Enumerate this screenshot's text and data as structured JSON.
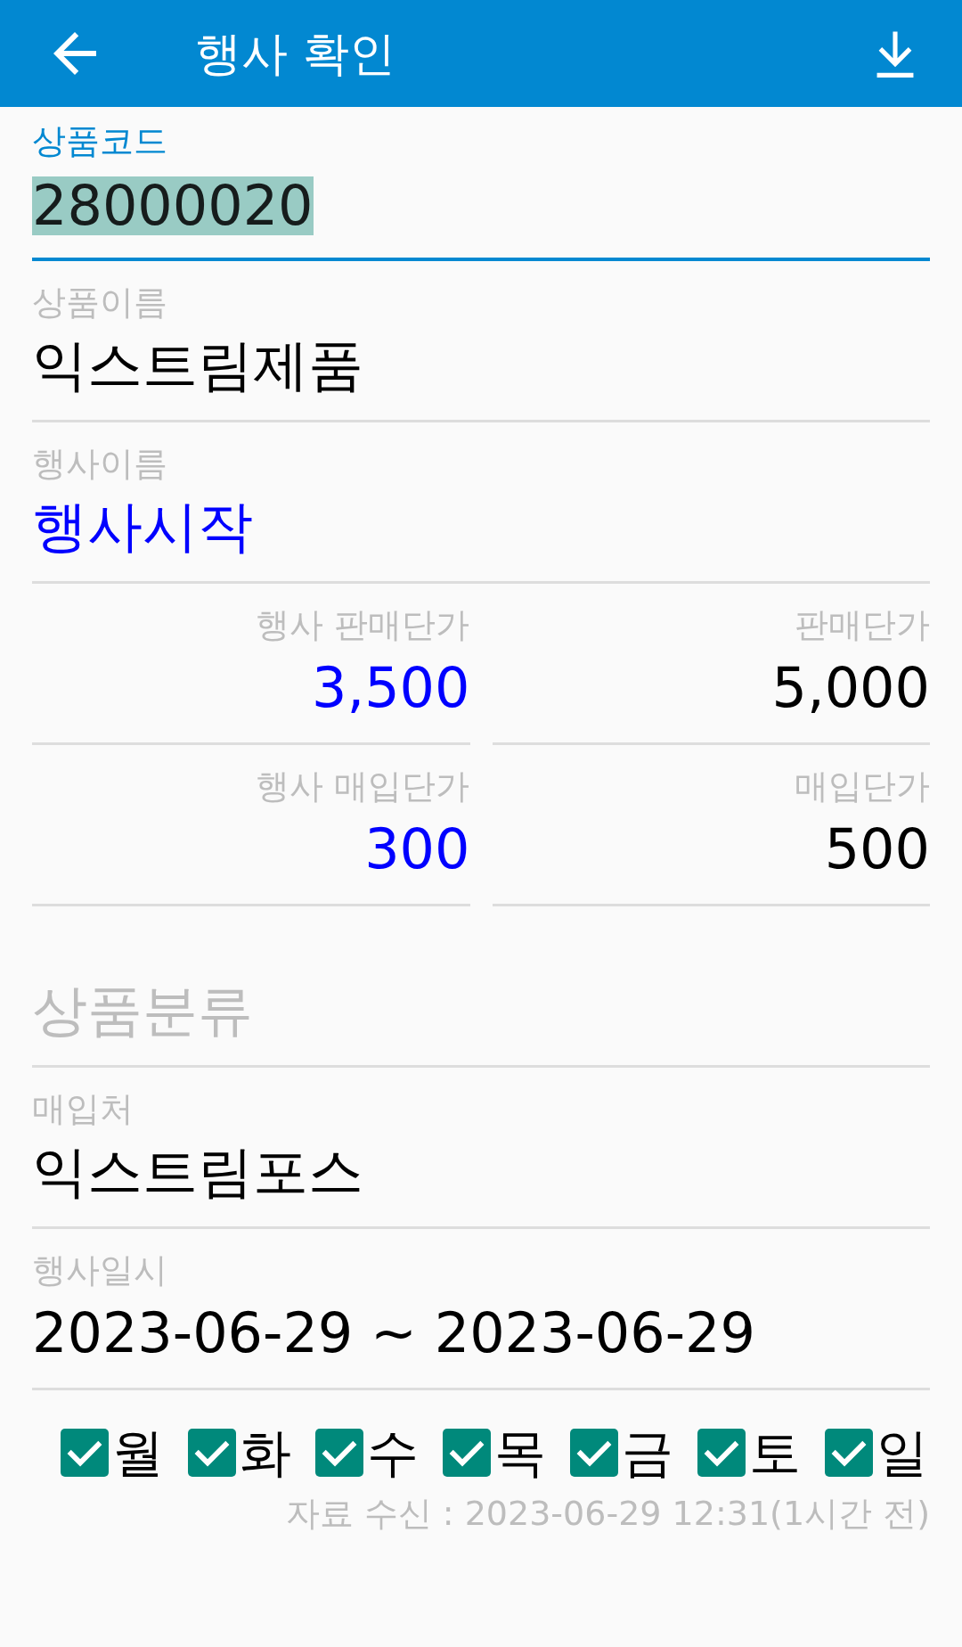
{
  "app_bar": {
    "title": "행사 확인"
  },
  "fields": [
    {
      "label": "상품코드",
      "value": "28000020",
      "focused": true,
      "text_selected": true,
      "emphasized": false
    },
    {
      "label": "상품이름",
      "value": "익스트림제품",
      "focused": false,
      "text_selected": false,
      "emphasized": false
    },
    {
      "label": "행사이름",
      "value": "행사시작",
      "focused": false,
      "text_selected": false,
      "emphasized": true
    }
  ],
  "prices": [
    {
      "label": "행사 판매단가",
      "value": "3,500",
      "emphasized": true
    },
    {
      "label": "판매단가",
      "value": "5,000",
      "emphasized": false
    },
    {
      "label": "행사 매입단가",
      "value": "300",
      "emphasized": true
    },
    {
      "label": "매입단가",
      "value": "500",
      "emphasized": false
    }
  ],
  "section": {
    "title": "상품분류"
  },
  "detail_fields": [
    {
      "label": "매입처",
      "value": "익스트림포스",
      "focused": false,
      "text_selected": false,
      "emphasized": false
    },
    {
      "label": "행사일시",
      "value": "2023-06-29 ~ 2023-06-29",
      "focused": false,
      "text_selected": false,
      "emphasized": false
    }
  ],
  "weekdays": [
    {
      "label": "월",
      "checked": true
    },
    {
      "label": "화",
      "checked": true
    },
    {
      "label": "수",
      "checked": true
    },
    {
      "label": "목",
      "checked": true
    },
    {
      "label": "금",
      "checked": true
    },
    {
      "label": "토",
      "checked": true
    },
    {
      "label": "일",
      "checked": true
    }
  ],
  "footer": {
    "text": "자료 수신 : 2023-06-29 12:31(1시간 전)"
  }
}
